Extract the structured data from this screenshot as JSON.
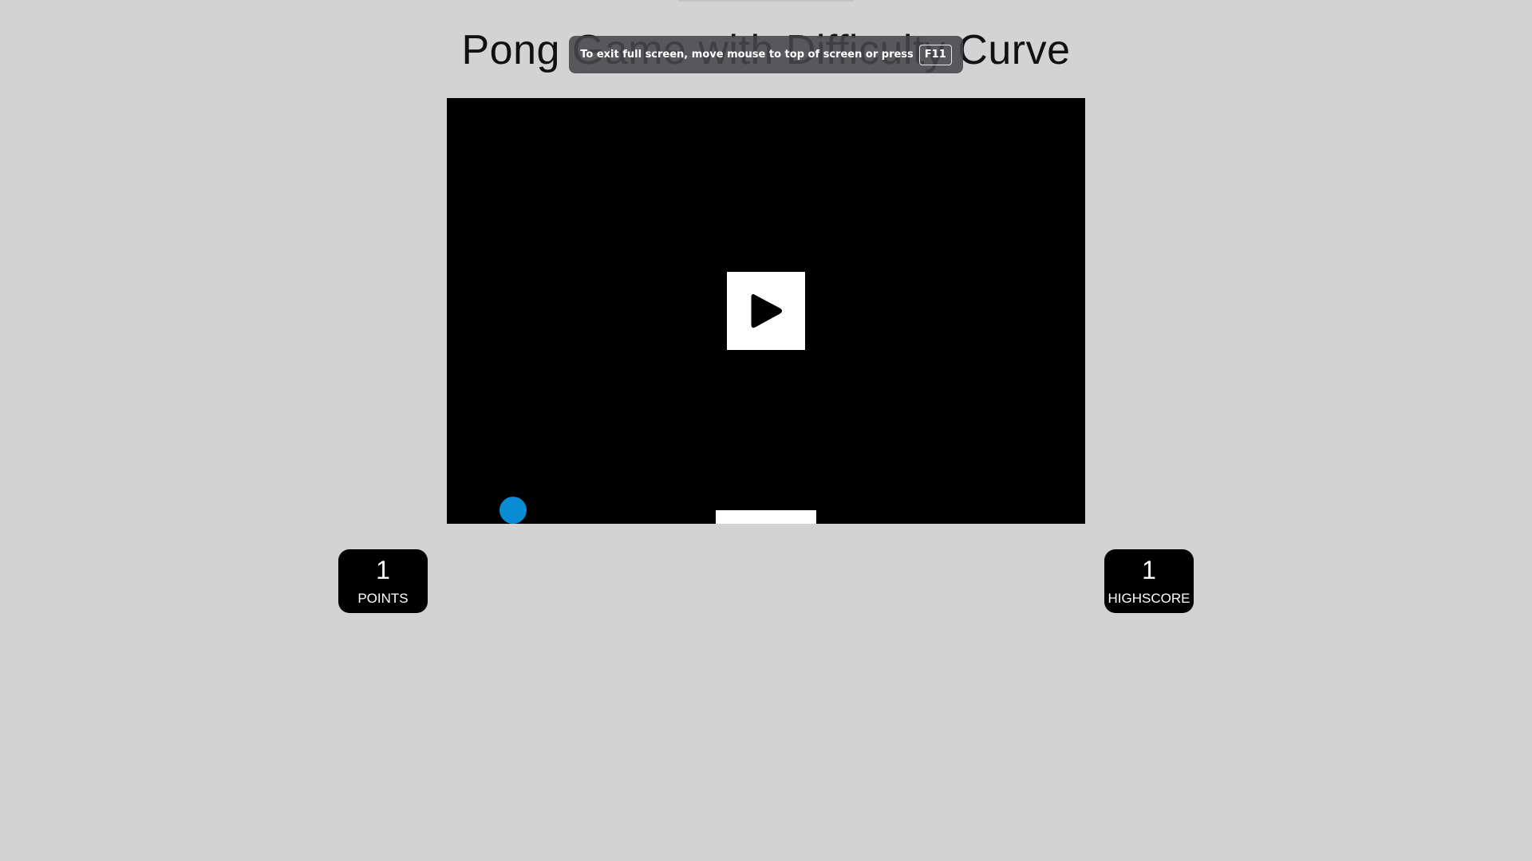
{
  "page": {
    "title": "Pong Game with Difficulty Curve"
  },
  "fullscreen_toast": {
    "message": "To exit full screen, move mouse to top of screen or press",
    "key": "F11"
  },
  "game": {
    "play_icon": "play-icon",
    "ball_color": "#0a8bd6"
  },
  "scores": {
    "points": {
      "value": "1",
      "label": "POINTS"
    },
    "highscore": {
      "value": "1",
      "label": "HIGHSCORE"
    }
  }
}
